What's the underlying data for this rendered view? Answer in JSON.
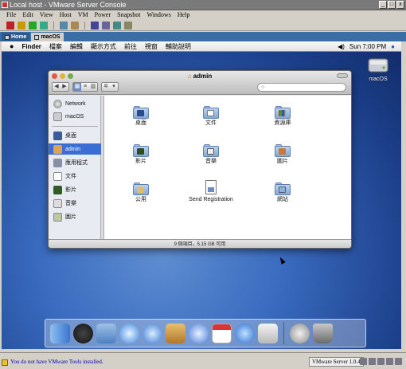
{
  "host_window": {
    "title": "Local host - VMware Server Console",
    "menu": [
      "File",
      "Edit",
      "View",
      "Host",
      "VM",
      "Power",
      "Snapshot",
      "Windows",
      "Help"
    ],
    "tabs": [
      {
        "label": "Home",
        "active": false
      },
      {
        "label": "macOS",
        "active": true
      }
    ],
    "status_message": "You do not have VMware Tools installed.",
    "version_label": "VMware Server 1.0.4"
  },
  "mac_menubar": {
    "app": "Finder",
    "items": [
      "檔案",
      "編輯",
      "顯示方式",
      "前往",
      "視窗",
      "輔助說明"
    ],
    "clock": "Sun 7:00 PM"
  },
  "desktop_icons": [
    {
      "label": "macOS",
      "icon": "hard-disk-icon"
    }
  ],
  "finder": {
    "title": "admin",
    "search_placeholder": "",
    "sidebar_top": [
      {
        "label": "Network",
        "icon": "globe-icon"
      },
      {
        "label": "macOS",
        "icon": "hard-disk-icon"
      }
    ],
    "sidebar_places": [
      {
        "label": "桌面",
        "icon": "desktop-icon",
        "selected": false
      },
      {
        "label": "admin",
        "icon": "home-icon",
        "selected": true
      },
      {
        "label": "應用程式",
        "icon": "applications-icon",
        "selected": false
      },
      {
        "label": "文件",
        "icon": "documents-icon",
        "selected": false
      },
      {
        "label": "影片",
        "icon": "movies-icon",
        "selected": false
      },
      {
        "label": "音樂",
        "icon": "music-icon",
        "selected": false
      },
      {
        "label": "圖片",
        "icon": "pictures-icon",
        "selected": false
      }
    ],
    "items": [
      {
        "label": "桌面",
        "icon": "desktop-folder-icon"
      },
      {
        "label": "文件",
        "icon": "documents-folder-icon"
      },
      {
        "label": "資源庫",
        "icon": "library-folder-icon"
      },
      {
        "label": "影片",
        "icon": "movies-folder-icon"
      },
      {
        "label": "音樂",
        "icon": "music-folder-icon"
      },
      {
        "label": "圖片",
        "icon": "pictures-folder-icon"
      },
      {
        "label": "公用",
        "icon": "public-folder-icon"
      },
      {
        "label": "Send Registration",
        "icon": "document-icon"
      },
      {
        "label": "網站",
        "icon": "sites-folder-icon"
      }
    ],
    "status": "9 個項目，5.15 GB 可用"
  },
  "dock_items": [
    "finder-icon",
    "dashboard-icon",
    "mail-icon",
    "safari-icon",
    "ichat-icon",
    "address-book-icon",
    "itunes-icon",
    "ical-icon",
    "quicktime-icon",
    "system-preferences-icon",
    "downloads-icon",
    "trash-icon"
  ],
  "colors": {
    "selection": "#3a6ed5",
    "desktop": "#3a6cc0",
    "host_tab": "#3a6ea5"
  }
}
